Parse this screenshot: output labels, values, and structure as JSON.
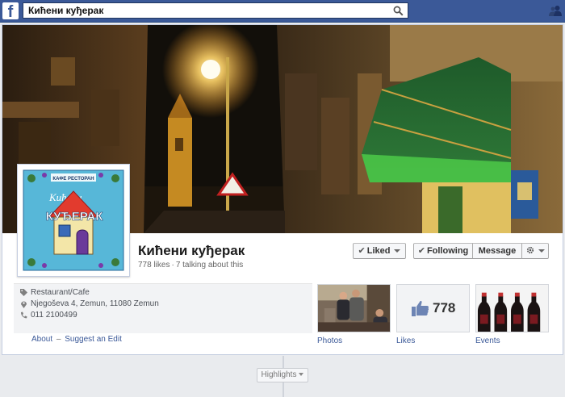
{
  "topbar": {
    "logo_letter": "f",
    "search_value": "Кићени куђерак"
  },
  "page": {
    "name": "Кићени куђерак",
    "likes_text": "778 likes",
    "talking_text": "7 talking about this",
    "separator": "·",
    "logo_small_text": "КАФЕ РЕСТОРАН",
    "logo_script_text": "Кићени",
    "logo_big_text": "КУЂЕРАК"
  },
  "actions": {
    "liked_label": "Liked",
    "following_label": "Following",
    "message_label": "Message",
    "check": "✔"
  },
  "about": {
    "category": "Restaurant/Cafe",
    "address": "Njegoševa 4, Zemun, 11080 Zemun",
    "phone": "011 2100499",
    "about_link": "About",
    "dash": "–",
    "suggest_link": "Suggest an Edit"
  },
  "apps": {
    "photos_label": "Photos",
    "likes_label": "Likes",
    "likes_count": "778",
    "events_label": "Events"
  },
  "timeline": {
    "highlights_label": "Highlights"
  },
  "colors": {
    "brand": "#3b5998",
    "link": "#3b5998",
    "logo_bg": "#57b7d8",
    "logo_roof": "#e23b2e"
  }
}
